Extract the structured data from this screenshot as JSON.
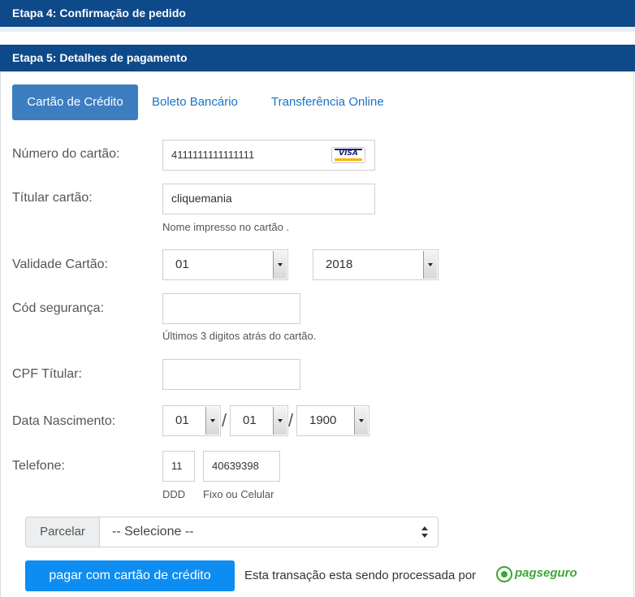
{
  "steps": {
    "step4_title": "Etapa 4: Confirmação de pedido",
    "step5_title": "Etapa 5: Detalhes de pagamento"
  },
  "tabs": [
    {
      "label": "Cartão de Crédito",
      "active": true
    },
    {
      "label": "Boleto Bancário",
      "active": false
    },
    {
      "label": "Transferência Online",
      "active": false
    }
  ],
  "form": {
    "card_number": {
      "label": "Número do cartão:",
      "value": "4111111111111111",
      "brand_icon": "visa-icon"
    },
    "holder": {
      "label": "Títular cartão:",
      "value": "cliquemania",
      "help": "Nome impresso no cartão ."
    },
    "expiry": {
      "label": "Validade Cartão:",
      "month": "01",
      "year": "2018"
    },
    "cvv": {
      "label": "Cód segurança:",
      "value": "",
      "help": "Últimos 3 digitos atrás do cartão."
    },
    "cpf": {
      "label": "CPF Títular:",
      "value": ""
    },
    "birth": {
      "label": "Data Nascimento:",
      "day": "01",
      "month": "01",
      "year": "1900",
      "separator": "/"
    },
    "phone": {
      "label": "Telefone:",
      "ddd": "11",
      "number": "40639398",
      "ddd_help": "DDD",
      "number_help": "Fixo ou Celular"
    }
  },
  "installments": {
    "addon": "Parcelar",
    "selected": "-- Selecione --"
  },
  "pay_button": "pagar com cartão de crédito",
  "processed_by": "Esta transação esta sendo processada por",
  "pagseguro": {
    "part1": "pag",
    "part2": "seguro"
  },
  "colors": {
    "header": "#0e4a8a",
    "tab_active": "#3d7ec1",
    "link": "#1a74c9",
    "pay_button": "#0d8df2",
    "pagseguro_green": "#3aa935"
  }
}
